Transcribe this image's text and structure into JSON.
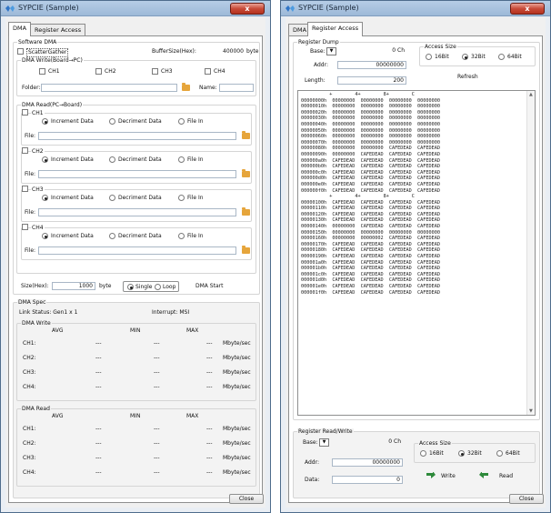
{
  "left": {
    "title": "SYPCIE (Sample)",
    "close_x": "x",
    "tabs": [
      "DMA",
      "Register Access"
    ],
    "software_dma": {
      "legend": "Software DMA",
      "scatter_gather": "ScatterGather",
      "buffer_label": "BufferSize(Hex):",
      "buffer_value": "400000",
      "buffer_unit": "byte"
    },
    "dma_write": {
      "legend": "DMA Write(Board→PC)",
      "channels": [
        "CH1",
        "CH2",
        "CH3",
        "CH4"
      ],
      "folder_label": "Folder:",
      "name_label": "Name:"
    },
    "dma_read": {
      "legend": "DMA Read(PC→Board)",
      "channels": [
        {
          "name": "CH1",
          "opts": [
            "Increment Data",
            "Decriment Data",
            "File In"
          ],
          "file": "File:"
        },
        {
          "name": "CH2",
          "opts": [
            "Increment Data",
            "Decriment Data",
            "File In"
          ],
          "file": "File:"
        },
        {
          "name": "CH3",
          "opts": [
            "Increment Data",
            "Decriment Data",
            "File In"
          ],
          "file": "File:"
        },
        {
          "name": "CH4",
          "opts": [
            "Increment Data",
            "Decriment Data",
            "File In"
          ],
          "file": "File:"
        }
      ]
    },
    "size_row": {
      "label": "Size(Hex):",
      "value": "1000",
      "unit": "byte",
      "single": "Single",
      "loop": "Loop",
      "start": "DMA Start"
    },
    "dma_spec": {
      "legend": "DMA Spec",
      "link_status": "Link Status:  Gen1 x 1",
      "interrupt": "Interrupt:  MSI",
      "write_legend": "DMA Write",
      "read_legend": "DMA Read",
      "cols": [
        "AVG",
        "MIN",
        "MAX"
      ],
      "rows": [
        {
          "ch": "CH1:",
          "avg": "---",
          "min": "---",
          "max": "---",
          "unit": "Mbyte/sec"
        },
        {
          "ch": "CH2:",
          "avg": "---",
          "min": "---",
          "max": "---",
          "unit": "Mbyte/sec"
        },
        {
          "ch": "CH3:",
          "avg": "---",
          "min": "---",
          "max": "---",
          "unit": "Mbyte/sec"
        },
        {
          "ch": "CH4:",
          "avg": "---",
          "min": "---",
          "max": "---",
          "unit": "Mbyte/sec"
        }
      ]
    },
    "close_label": "Close"
  },
  "right": {
    "title": "SYPCIE (Sample)",
    "close_x": "x",
    "tabs": [
      "DMA",
      "Register Access"
    ],
    "dump": {
      "legend": "Register Dump",
      "base_label": "Base:",
      "base_value": "0 Ch",
      "addr_label": "Addr:",
      "addr_value": "00000000",
      "length_label": "Length:",
      "length_value": "200",
      "access_legend": "Access Size",
      "access_opts": [
        "16Bit",
        "32Bit",
        "64Bit"
      ],
      "refresh_label": "Refresh",
      "lines": [
        "          +        4+        8+        C",
        "00000000h  00000000  00000000  00000000  00000000",
        "00000010h  00000000  00000000  00000000  00000000",
        "00000020h  00000000  00000000  00000000  00000000",
        "00000030h  00000000  00000000  00000000  00000000",
        "00000040h  00000000  00000000  00000000  00000000",
        "00000050h  00000000  00000000  00000000  00000000",
        "00000060h  00000000  00000000  00000000  00000000",
        "00000070h  00000000  00000000  00000000  00000000",
        "00000080h  00000000  00000000  CAFEDEAD  CAFEDEAD",
        "00000090h  00000000  CAFEDEAD  CAFEDEAD  CAFEDEAD",
        "000000a0h  CAFEDEAD  CAFEDEAD  CAFEDEAD  CAFEDEAD",
        "000000b0h  CAFEDEAD  CAFEDEAD  CAFEDEAD  CAFEDEAD",
        "000000c0h  CAFEDEAD  CAFEDEAD  CAFEDEAD  CAFEDEAD",
        "000000d0h  CAFEDEAD  CAFEDEAD  CAFEDEAD  CAFEDEAD",
        "000000e0h  CAFEDEAD  CAFEDEAD  CAFEDEAD  CAFEDEAD",
        "000000f0h  CAFEDEAD  CAFEDEAD  CAFEDEAD  CAFEDEAD",
        "          +        4+        8+        C",
        "00000100h  CAFEDEAD  CAFEDEAD  CAFEDEAD  CAFEDEAD",
        "00000110h  CAFEDEAD  CAFEDEAD  CAFEDEAD  CAFEDEAD",
        "00000120h  CAFEDEAD  CAFEDEAD  CAFEDEAD  CAFEDEAD",
        "00000130h  CAFEDEAD  CAFEDEAD  CAFEDEAD  CAFEDEAD",
        "00000140h  00000000  CAFEDEAD  CAFEDEAD  CAFEDEAD",
        "00000150h  00000000  00000000  00000000  00000000",
        "00000160h  00000000  00000002  CAFEDEAD  CAFEDEAD",
        "00000170h  CAFEDEAD  CAFEDEAD  CAFEDEAD  CAFEDEAD",
        "00000180h  CAFEDEAD  CAFEDEAD  CAFEDEAD  CAFEDEAD",
        "00000190h  CAFEDEAD  CAFEDEAD  CAFEDEAD  CAFEDEAD",
        "000001a0h  CAFEDEAD  CAFEDEAD  CAFEDEAD  CAFEDEAD",
        "000001b0h  CAFEDEAD  CAFEDEAD  CAFEDEAD  CAFEDEAD",
        "000001c0h  CAFEDEAD  CAFEDEAD  CAFEDEAD  CAFEDEAD",
        "000001d0h  CAFEDEAD  CAFEDEAD  CAFEDEAD  CAFEDEAD",
        "000001e0h  CAFEDEAD  CAFEDEAD  CAFEDEAD  CAFEDEAD",
        "000001f0h  CAFEDEAD  CAFEDEAD  CAFEDEAD  CAFEDEAD"
      ]
    },
    "rw": {
      "legend": "Register Read/Write",
      "base_label": "Base:",
      "base_value": "0 Ch",
      "addr_label": "Addr:",
      "addr_value": "00000000",
      "data_label": "Data:",
      "data_value": "0",
      "access_legend": "Access Size",
      "access_opts": [
        "16Bit",
        "32Bit",
        "64Bit"
      ],
      "write_label": "Write",
      "read_label": "Read"
    },
    "close_label": "Close"
  },
  "colors": {
    "titlebar": "#a6c1df",
    "close": "#c84a38",
    "folder": "#e6a53b",
    "arrow": "#2e8a3b"
  }
}
